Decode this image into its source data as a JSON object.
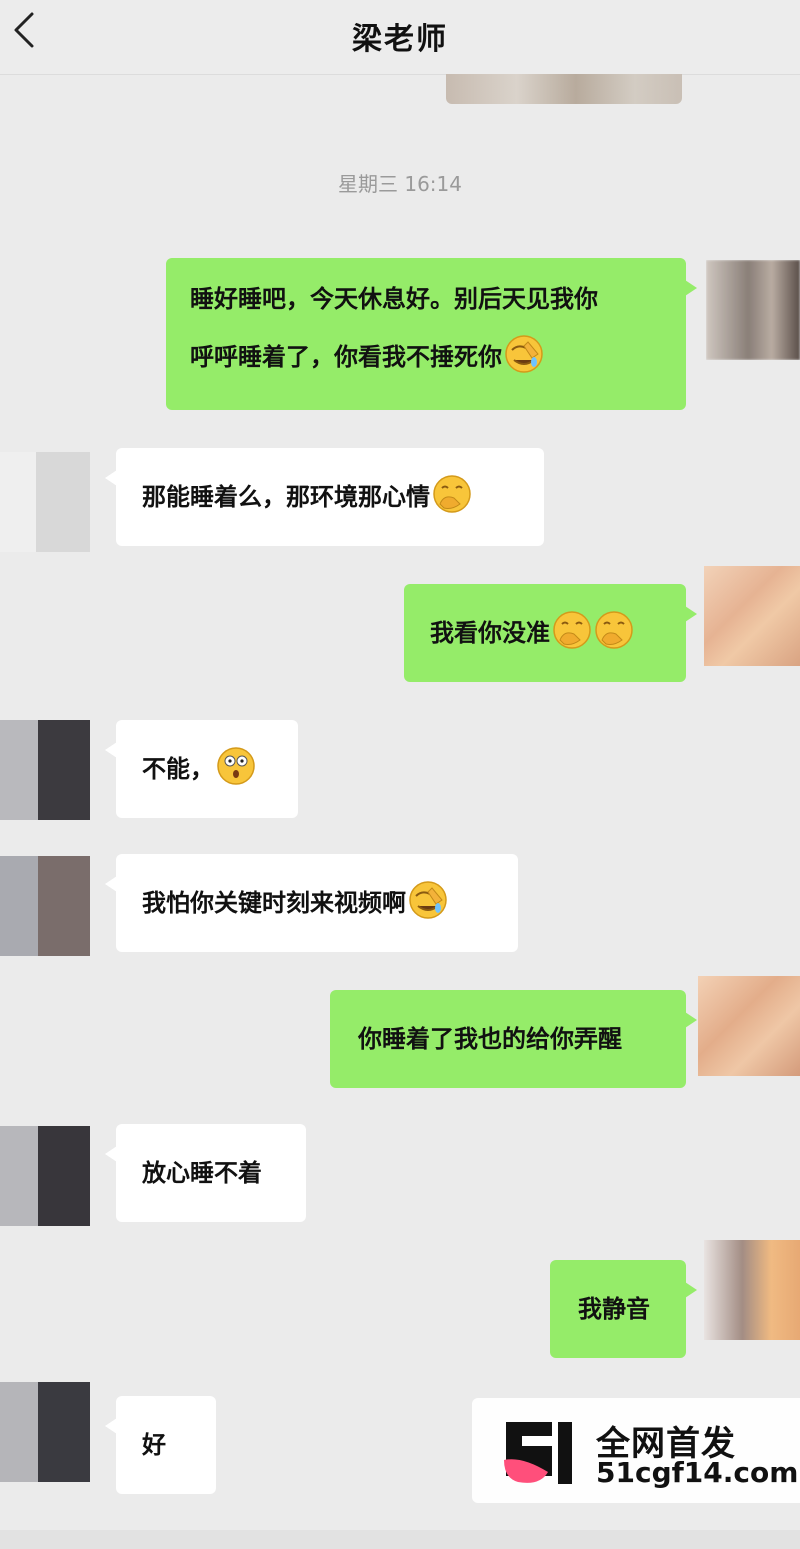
{
  "header": {
    "title": "梁老师",
    "back_icon": "chevron-left-icon"
  },
  "timestamp": "星期三 16:14",
  "messages": [
    {
      "side": "me",
      "text_line1": "睡好睡吧，今天休息好。别后天见我你",
      "text_line2": "呼呼睡着了，你看我不捶死你",
      "emoji": "facepalm-laugh-icon"
    },
    {
      "side": "other",
      "text": "那能睡着么，那环境那心情",
      "emoji": "hand-over-mouth-laugh-icon"
    },
    {
      "side": "me",
      "text": "我看你没准",
      "emoji": "hand-over-mouth-laugh-icon"
    },
    {
      "side": "other",
      "text": "不能，",
      "emoji": "shocked-face-icon"
    },
    {
      "side": "other",
      "text": "我怕你关键时刻来视频啊",
      "emoji": "facepalm-laugh-icon"
    },
    {
      "side": "me",
      "text": "你睡着了我也的给你弄醒"
    },
    {
      "side": "other",
      "text": "放心睡不着"
    },
    {
      "side": "me",
      "text": "我静音"
    },
    {
      "side": "other",
      "text": "好"
    }
  ],
  "watermark": {
    "line1": "全网首发",
    "line2": "51cgf14.com",
    "logo": "51-logo"
  },
  "colors": {
    "my_bubble": "#95ec69",
    "other_bubble": "#ffffff",
    "background": "#ebebeb"
  }
}
